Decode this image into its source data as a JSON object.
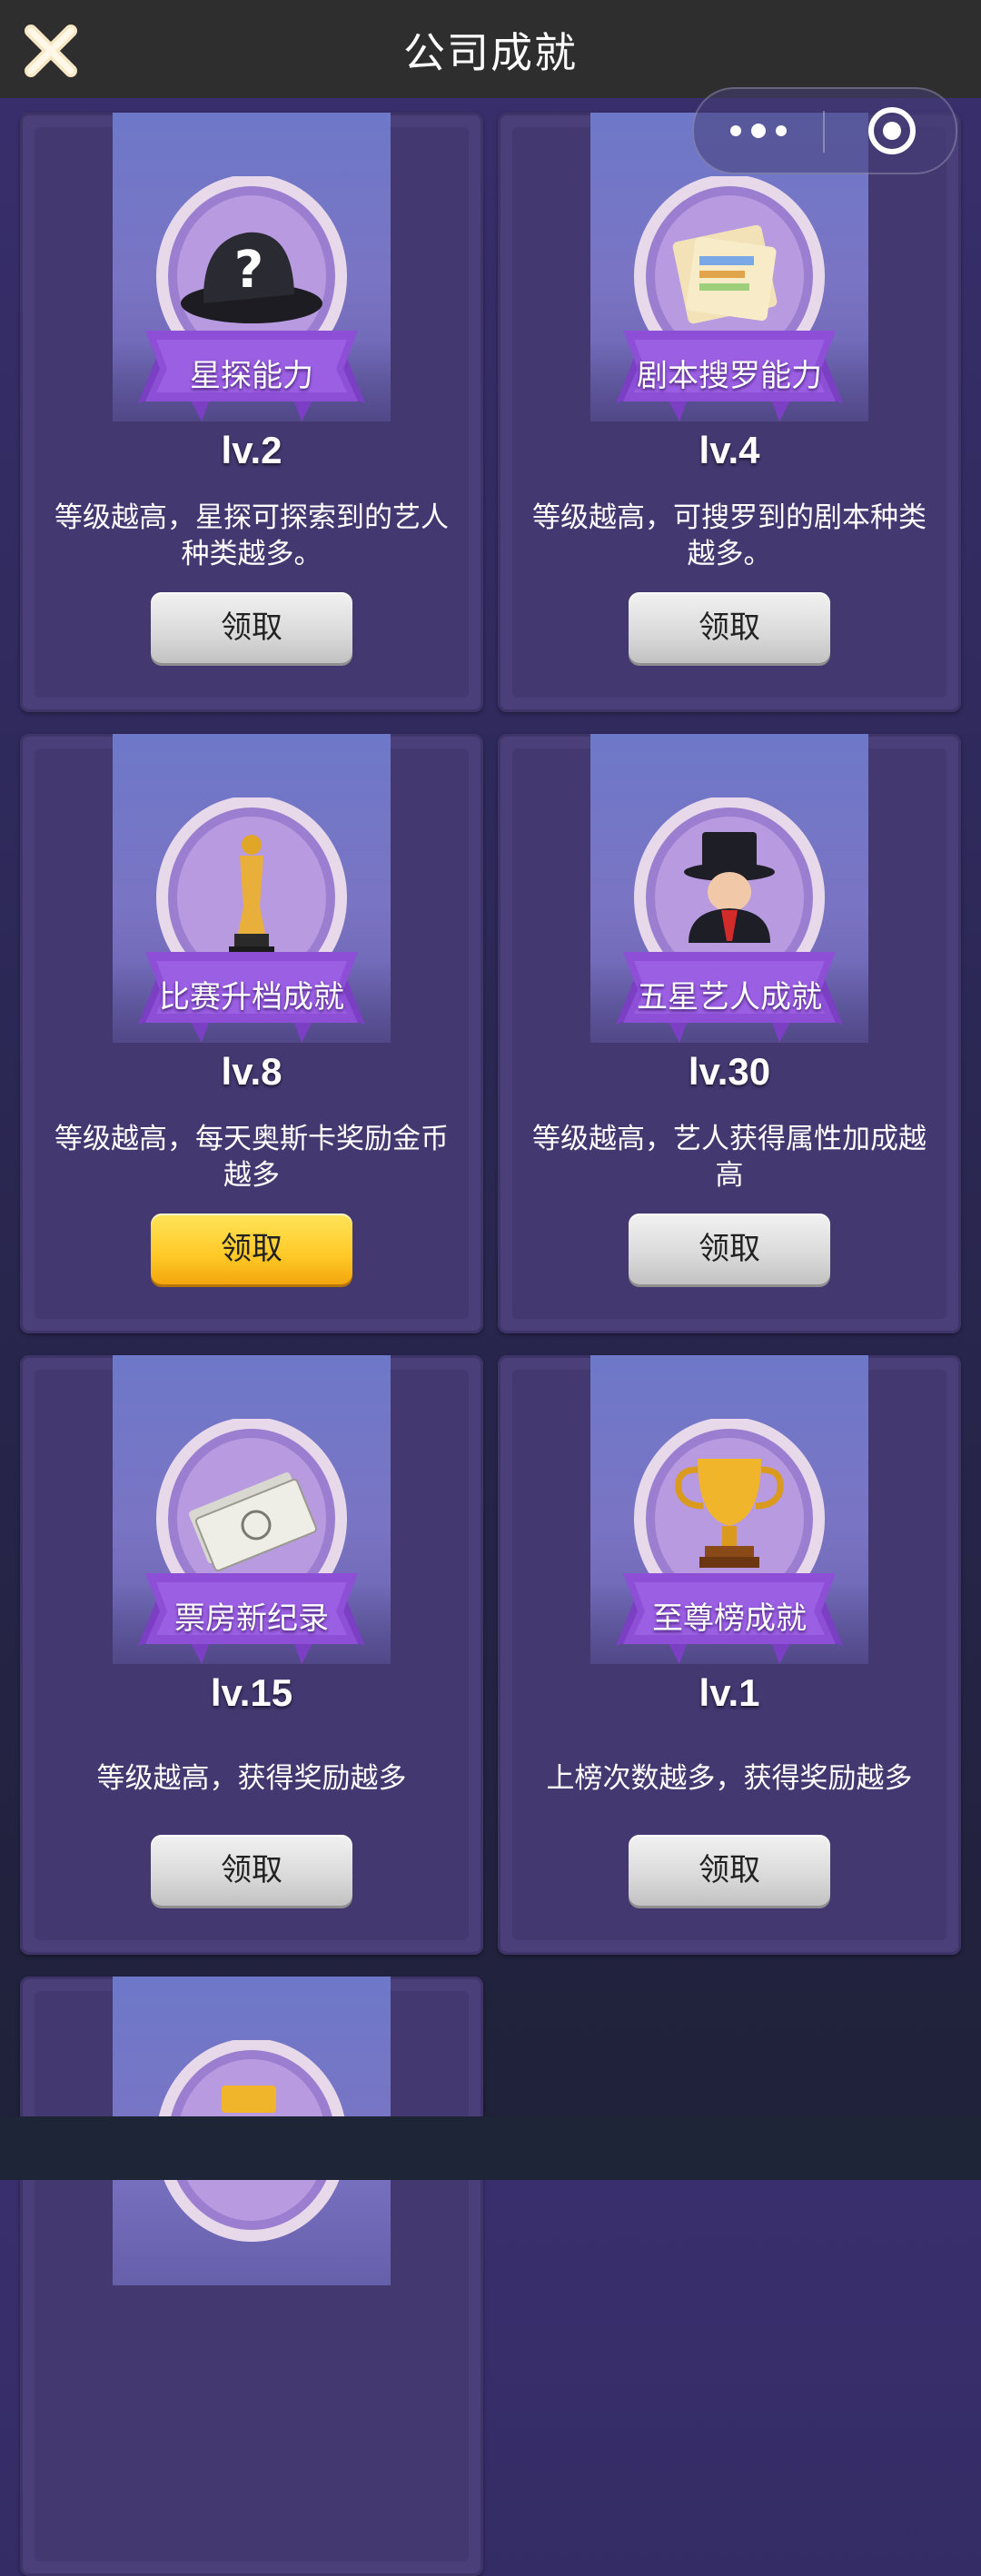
{
  "header": {
    "title": "公司成就",
    "close_icon": "close-icon"
  },
  "capsule": {
    "more_icon": "more-dots-icon",
    "exit_icon": "target-icon"
  },
  "colors": {
    "active_button": "#ffc927",
    "inactive_button": "#d9d9d9",
    "card_bg": "#4a3f78",
    "banner": "#6e78c8"
  },
  "achievements": [
    {
      "title": "星探能力",
      "level": "lv.2",
      "description": "等级越高，星探可探索到的艺人种类越多。",
      "button": "领取",
      "button_active": false,
      "icon": "mystery-hat-icon"
    },
    {
      "title": "剧本搜罗能力",
      "level": "lv.4",
      "description": "等级越高，可搜罗到的剧本种类越多。",
      "button": "领取",
      "button_active": false,
      "icon": "script-documents-icon"
    },
    {
      "title": "比赛升档成就",
      "level": "lv.8",
      "description": "等级越高，每天奥斯卡奖励金币越多",
      "button": "领取",
      "button_active": true,
      "icon": "oscar-statue-icon"
    },
    {
      "title": "五星艺人成就",
      "level": "lv.30",
      "description": "等级越高，艺人获得属性加成越高",
      "button": "领取",
      "button_active": false,
      "icon": "top-hat-gentleman-icon"
    },
    {
      "title": "票房新纪录",
      "level": "lv.15",
      "description": "等级越高，获得奖励越多",
      "button": "领取",
      "button_active": false,
      "icon": "cash-stack-icon"
    },
    {
      "title": "至尊榜成就",
      "level": "lv.1",
      "description": "上榜次数越多，获得奖励越多",
      "button": "领取",
      "button_active": false,
      "icon": "gold-trophy-icon"
    },
    {
      "title": "",
      "level": "",
      "description": "",
      "button": "",
      "button_active": false,
      "icon": "gold-item-icon"
    }
  ]
}
